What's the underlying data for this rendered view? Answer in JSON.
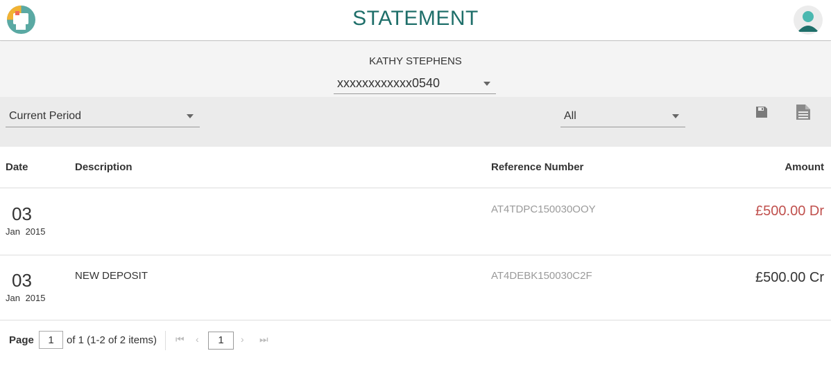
{
  "header": {
    "title": "STATEMENT",
    "logo_icon": "app-logo-icon",
    "avatar_icon": "user-avatar-icon"
  },
  "account": {
    "holder_name": "KATHY STEPHENS",
    "selected_account": "xxxxxxxxxxxx0540"
  },
  "filters": {
    "period": "Current Period",
    "type": "All",
    "save_icon": "save-icon",
    "document_icon": "document-icon"
  },
  "table": {
    "headers": {
      "date": "Date",
      "description": "Description",
      "reference": "Reference Number",
      "amount": "Amount"
    },
    "rows": [
      {
        "day": "03",
        "month_year": "Jan 2015",
        "description": "",
        "reference": "AT4TDPC150030OOY",
        "amount": "£500.00 Dr"
      },
      {
        "day": "03",
        "month_year": "Jan 2015",
        "description": "NEW DEPOSIT",
        "reference": "AT4DEBK150030C2F",
        "amount": "£500.00 Cr"
      }
    ]
  },
  "pager": {
    "label": "Page",
    "page_value": "1",
    "of_text": "of 1 (1-2 of 2 items)",
    "current_page": "1"
  },
  "colors": {
    "brand": "#1f6f6a",
    "debit": "#c0504d",
    "credit": "#333333"
  }
}
